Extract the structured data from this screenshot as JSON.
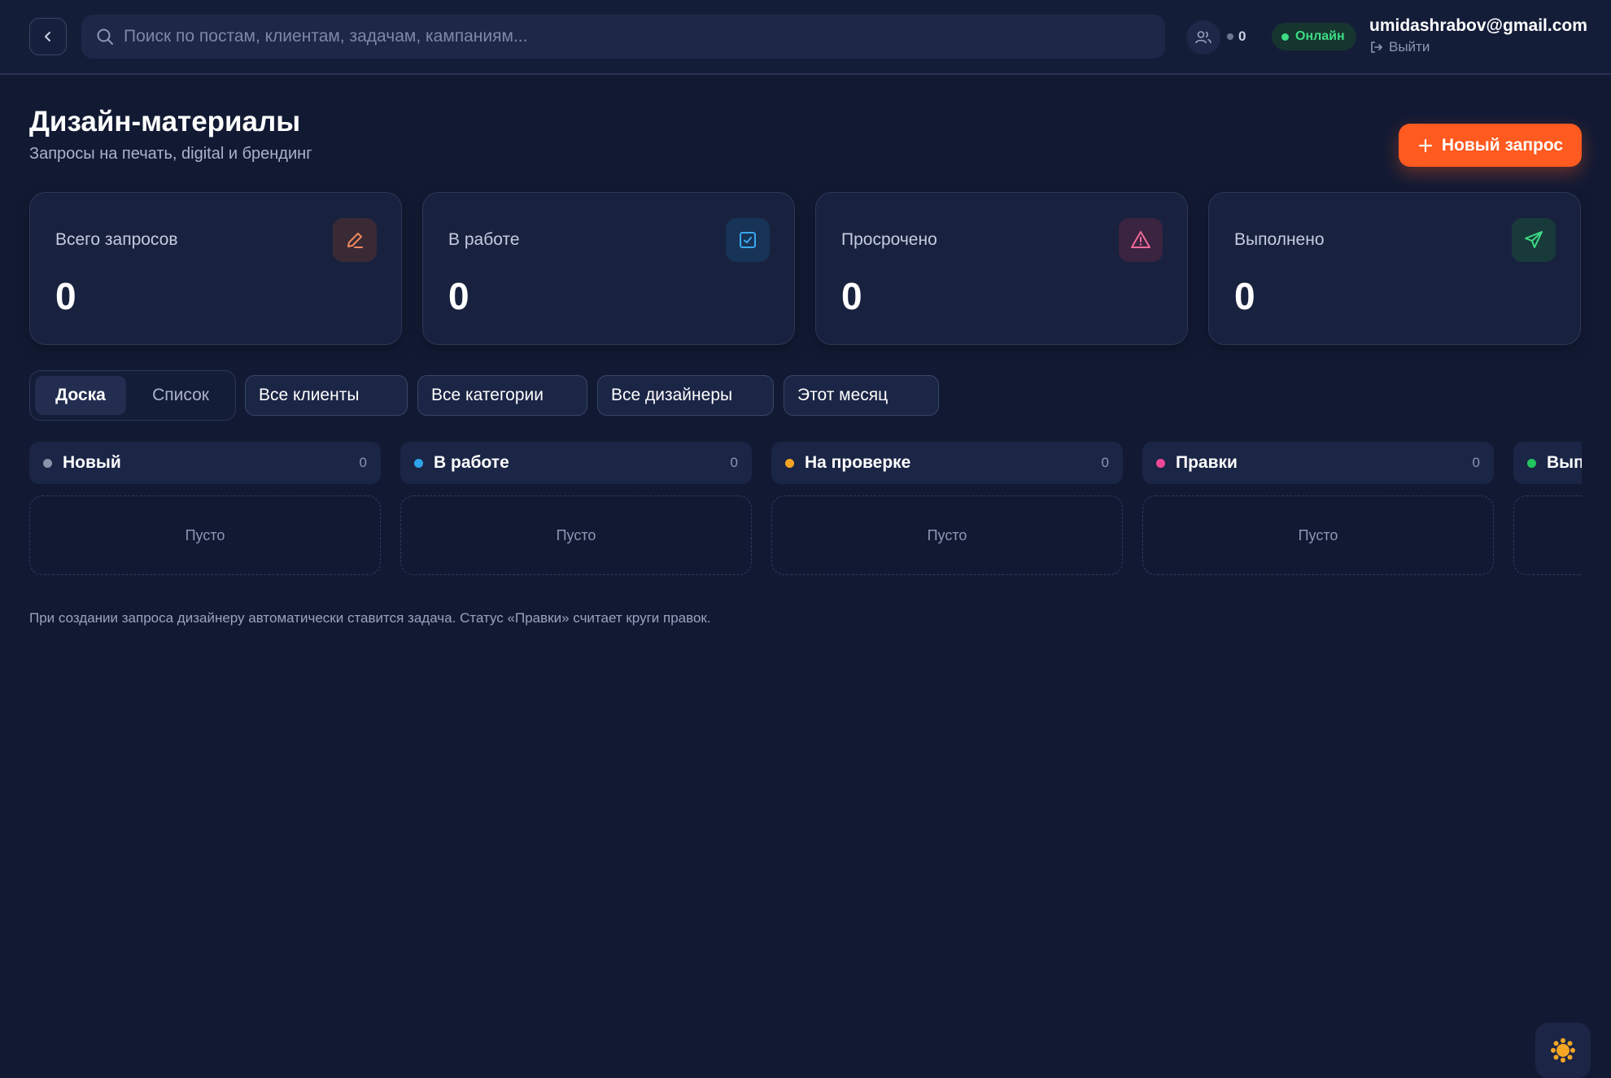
{
  "header": {
    "search_placeholder": "Поиск по постам, клиентам, задачам, кампаниям...",
    "users_count": "0",
    "status_label": "Онлайн",
    "user_email": "umidashrabov@gmail.com",
    "logout_label": "Выйти"
  },
  "page": {
    "title": "Дизайн-материалы",
    "subtitle": "Запросы на печать, digital и брендинг",
    "new_request_label": "Новый запрос"
  },
  "stats": [
    {
      "label": "Всего запросов",
      "value": "0",
      "icon": "pencil-icon",
      "color": "#f08a5d"
    },
    {
      "label": "В работе",
      "value": "0",
      "icon": "checkbox-icon",
      "color": "#3ba7f0"
    },
    {
      "label": "Просрочено",
      "value": "0",
      "icon": "warning-icon",
      "color": "#f06a9a"
    },
    {
      "label": "Выполнено",
      "value": "0",
      "icon": "send-icon",
      "color": "#3ddc84"
    }
  ],
  "view_toggle": {
    "board_label": "Доска",
    "list_label": "Список",
    "selected": "Доска"
  },
  "filters": {
    "clients": "Все клиенты",
    "categories": "Все категории",
    "designers": "Все дизайнеры",
    "period": "Этот месяц"
  },
  "columns": [
    {
      "name": "Новый",
      "count": "0",
      "dot_color": "#8a93ab",
      "empty_label": "Пусто"
    },
    {
      "name": "В работе",
      "count": "0",
      "dot_color": "#2fa4ea",
      "empty_label": "Пусто"
    },
    {
      "name": "На проверке",
      "count": "0",
      "dot_color": "#f5a524",
      "empty_label": "Пусто"
    },
    {
      "name": "Правки",
      "count": "0",
      "dot_color": "#ec4899",
      "empty_label": "Пусто"
    },
    {
      "name": "Вып",
      "count": "",
      "dot_color": "#22c55e",
      "empty_label": ""
    }
  ],
  "footnote": "При создании запроса дизайнеру автоматически ставится задача. Статус «Правки» считает круги правок.",
  "theme_toggle_icon": "sun-icon"
}
